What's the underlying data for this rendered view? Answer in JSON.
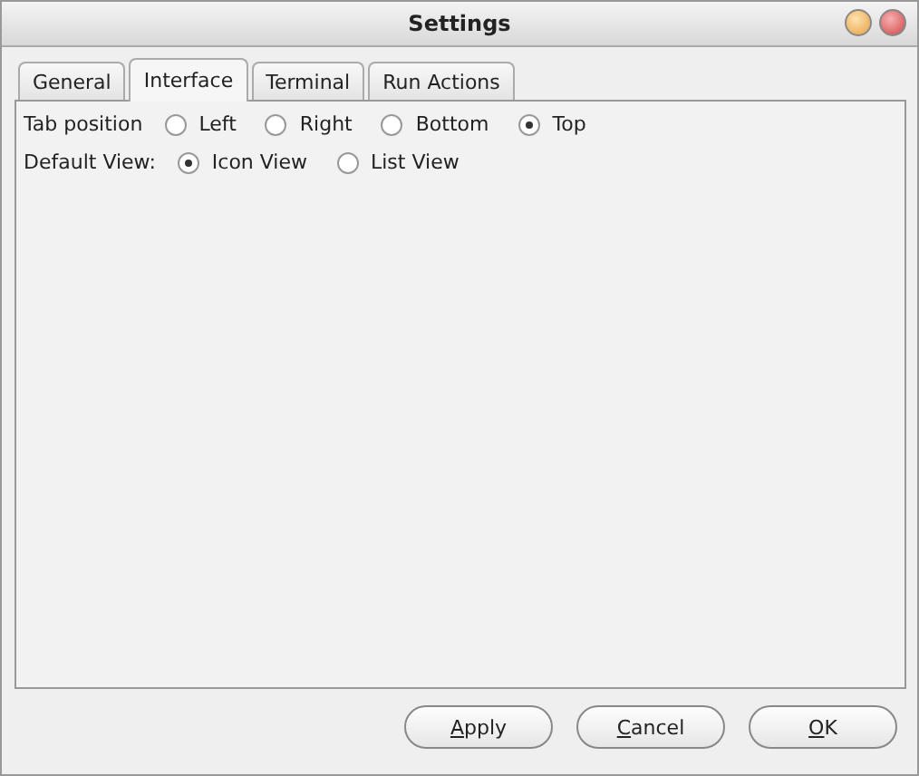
{
  "window": {
    "title": "Settings"
  },
  "tabs": [
    {
      "label": "General",
      "selected": false
    },
    {
      "label": "Interface",
      "selected": true
    },
    {
      "label": "Terminal",
      "selected": false
    },
    {
      "label": "Run Actions",
      "selected": false
    }
  ],
  "settings": [
    {
      "label": "Tab position",
      "options": [
        {
          "label": "Left",
          "selected": false
        },
        {
          "label": "Right",
          "selected": false
        },
        {
          "label": "Bottom",
          "selected": false
        },
        {
          "label": "Top",
          "selected": true
        }
      ]
    },
    {
      "label": "Default View:",
      "options": [
        {
          "label": "Icon View",
          "selected": true
        },
        {
          "label": "List View",
          "selected": false
        }
      ]
    }
  ],
  "buttons": [
    {
      "mnemonic": "A",
      "rest": "pply"
    },
    {
      "mnemonic": "C",
      "rest": "ancel"
    },
    {
      "mnemonic": "O",
      "rest": "K"
    }
  ]
}
